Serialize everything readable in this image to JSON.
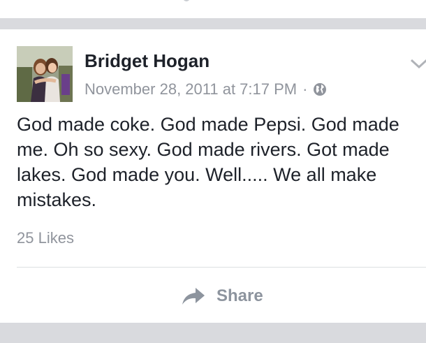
{
  "post": {
    "author_name": "Bridget Hogan",
    "timestamp": "November 28, 2011 at 7:17 PM",
    "separator": "·",
    "privacy_icon": "globe-icon",
    "text": "God made coke. God made Pepsi. God made me. Oh so sexy. God made rivers. Got made lakes. God made you. Well..... We all make mistakes.",
    "likes": "25 Likes",
    "share_label": "Share",
    "share_icon": "share-arrow-icon",
    "menu_icon": "chevron-down-icon"
  },
  "colors": {
    "text_primary": "#1d2129",
    "text_secondary": "#90949c",
    "separator_bg": "#d9dade"
  }
}
